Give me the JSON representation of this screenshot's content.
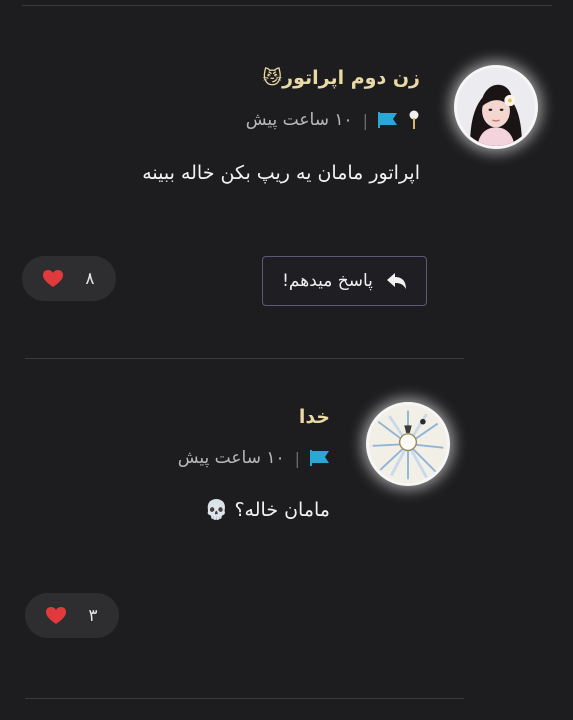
{
  "colors": {
    "background": "#1d1d1f",
    "username_gold": "#e9d9a4",
    "heart_red": "#e03a3c",
    "flag_blue": "#29a8d8"
  },
  "comments": [
    {
      "username": "زن دوم اپراتور",
      "username_emoji": "😼",
      "time": "۱۰ ساعت پیش",
      "separator": "|",
      "text": "اپراتور مامان یه ریپ بکن خاله ببینه",
      "likes": "۸",
      "reply_label": "پاسخ میدهم!",
      "pinned": true
    },
    {
      "username": "خدا",
      "time": "۱۰ ساعت پیش",
      "separator": "|",
      "text": "مامان خاله؟",
      "text_emoji": "💀",
      "likes": "۳"
    }
  ],
  "icons": [
    "flag-icon",
    "pin-icon",
    "heart-icon",
    "reply-icon",
    "avatar"
  ]
}
